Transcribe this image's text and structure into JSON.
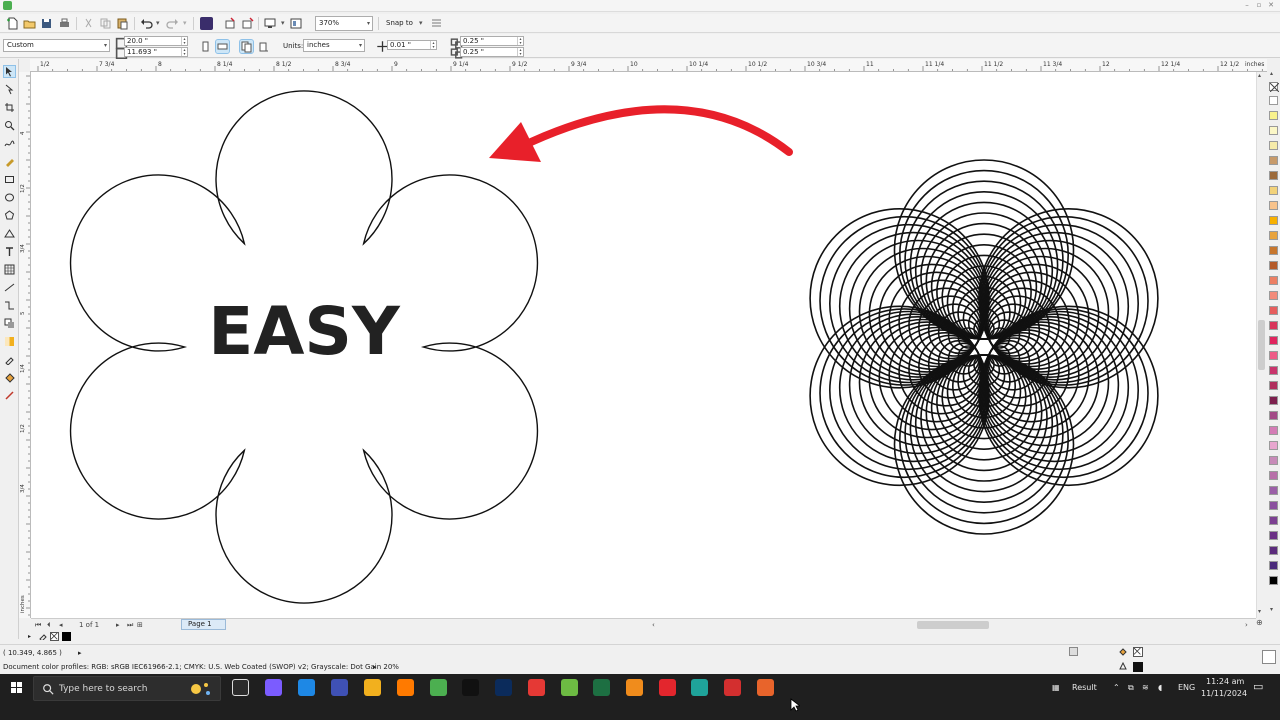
{
  "window": {
    "minimize": "–",
    "restore": "▫",
    "close": "✕"
  },
  "toolbar": {
    "zoom_value": "370%",
    "snap_label": "Snap to"
  },
  "property_bar": {
    "preset": "Custom",
    "page_width": "20.0 \"",
    "page_height": "11.693 \"",
    "units_label": "Units:",
    "units_value": "inches",
    "nudge": "0.01 \"",
    "dup_x": "0.25 \"",
    "dup_y": "0.25 \""
  },
  "ruler_h": {
    "unit": "inches",
    "labels": [
      "1/2",
      "7 3/4",
      "8",
      "8 1/4",
      "8 1/2",
      "8 3/4",
      "9",
      "9 1/4",
      "9 1/2",
      "9 3/4",
      "10",
      "10 1/4",
      "10 1/2",
      "10 3/4",
      "11",
      "11 1/4",
      "11 1/2",
      "11 3/4",
      "12",
      "12 1/4",
      "12 1/2"
    ]
  },
  "ruler_v": {
    "labels": [
      "4",
      "1/2",
      "3/4",
      "5",
      "1/4",
      "1/2",
      "3/4",
      "inches"
    ]
  },
  "canvas": {
    "easy_text": "EASY",
    "arrow_color": "#e8202a",
    "stroke_color": "#111111"
  },
  "page_nav": {
    "counter": "1 of 1",
    "page_tab": "Page 1"
  },
  "status": {
    "coords": "( 10.349, 4.865 )",
    "color_profiles": "Document color profiles: RGB: sRGB IEC61966-2.1; CMYK: U.S. Web Coated (SWOP) v2; Grayscale: Dot Gain 20%"
  },
  "palette": [
    "#ffffff",
    "#f9f28d",
    "#fbf7c7",
    "#f6eba9",
    "#c79a6a",
    "#9c6a3b",
    "#f2d27a",
    "#f8c38c",
    "#f7b000",
    "#e8a33d",
    "#c7762d",
    "#b45a2a",
    "#ec7f63",
    "#f28b7a",
    "#e65d5d",
    "#d8355a",
    "#e0245e",
    "#ee5b87",
    "#c8336b",
    "#b02e5d",
    "#7b1e4c",
    "#a24a86",
    "#d37bb5",
    "#e8a6cf",
    "#c78ab8",
    "#b76fa8",
    "#9b5fa7",
    "#8a4f9e",
    "#7b3f91",
    "#6a2f84",
    "#5b2b7c",
    "#4a2a7a",
    "#000000"
  ],
  "taskbar": {
    "search_placeholder": "Type here to search",
    "result_label": "Result",
    "lang": "ENG",
    "time": "11:24 am",
    "date": "11/11/2024",
    "apps": [
      "task-view",
      "copilot",
      "edge",
      "calculator",
      "file-explorer",
      "illustrator",
      "coreldraw",
      "tiktok",
      "photoshop",
      "chrome",
      "coreldraw-2",
      "excel",
      "paint",
      "opera",
      "camtasia",
      "record",
      "other"
    ]
  }
}
